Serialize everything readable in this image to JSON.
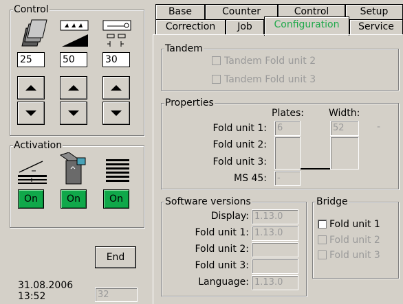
{
  "control": {
    "title": "Control",
    "icons": [
      "plates-stack-icon",
      "ink-wedge-icon",
      "fold-settings-icon"
    ],
    "values": [
      "25",
      "50",
      "30"
    ]
  },
  "activation": {
    "title": "Activation",
    "icons": [
      "fold-unit-icon",
      "stacker-machine-icon",
      "paper-stack-icon"
    ],
    "buttons": [
      "On",
      "On",
      "On"
    ],
    "button_color": "#10a84a"
  },
  "end_label": "End",
  "status": {
    "date": "31.08.2006",
    "time": "13:52",
    "counter": "32"
  },
  "tabs": {
    "row1": [
      "Base",
      "Counter",
      "Control",
      "Setup"
    ],
    "row2": [
      "Correction",
      "Job",
      "Configuration",
      "Service"
    ],
    "active": "Configuration",
    "active_color": "#1fa84a"
  },
  "tandem": {
    "title": "Tandem",
    "items": [
      "Tandem Fold unit 2",
      "Tandem Fold unit 3"
    ]
  },
  "properties": {
    "title": "Properties",
    "col_plates": "Plates:",
    "col_width": "Width:",
    "rows": [
      "Fold unit 1:",
      "Fold unit 2:",
      "Fold unit 3:",
      "MS 45:"
    ],
    "plates_value": "6",
    "width_value": "52",
    "ms45_value": "-",
    "side_dash": "-"
  },
  "software": {
    "title": "Software versions",
    "rows": [
      {
        "label": "Display:",
        "value": "1.13.0"
      },
      {
        "label": "Fold unit 1:",
        "value": "1.13.0"
      },
      {
        "label": "Fold unit 2:",
        "value": ""
      },
      {
        "label": "Fold unit 3:",
        "value": ""
      },
      {
        "label": "Language:",
        "value": "1.13.0"
      }
    ]
  },
  "bridge": {
    "title": "Bridge",
    "items": [
      "Fold unit 1",
      "Fold unit 2",
      "Fold unit 3"
    ]
  }
}
